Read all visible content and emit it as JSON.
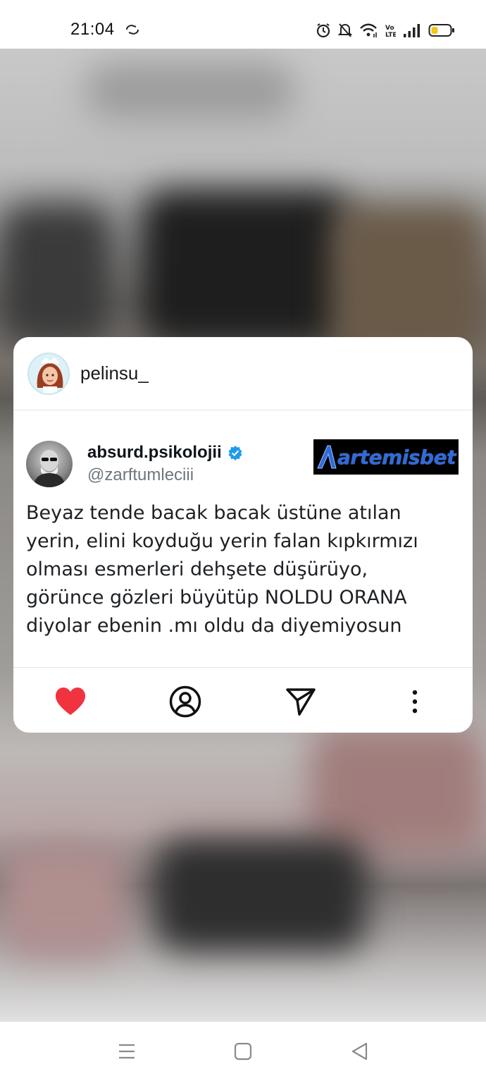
{
  "status_bar": {
    "time": "21:04",
    "icons": [
      "sync-icon",
      "alarm-icon",
      "mute-icon",
      "wifi-icon",
      "volte-icon",
      "signal-icon",
      "battery-icon"
    ]
  },
  "post": {
    "username": "pelinsu_",
    "tweet": {
      "display_name": "absurd.psikolojii",
      "verified": true,
      "handle": "@zarftumleciii",
      "ad_text": "artemisbet",
      "lines": [
        "Beyaz tende bacak bacak üstüne atılan",
        "yerin, elini koyduğu yerin falan kıpkırmızı",
        "olması esmerleri dehşete düşürüyo,",
        "görünce gözleri büyütüp NOLDU ORANA",
        "diyolar ebenin .mı oldu da diyemiyosun"
      ]
    },
    "actions": [
      "heart-icon",
      "profile-icon",
      "send-icon",
      "more-icon"
    ]
  },
  "colors": {
    "like": "#f0333f",
    "verified": "#1d9bf0",
    "ad_bg": "#000000",
    "ad_text": "#2f6bd8"
  },
  "nav_bar": [
    "recent-apps-icon",
    "home-icon",
    "back-icon"
  ]
}
